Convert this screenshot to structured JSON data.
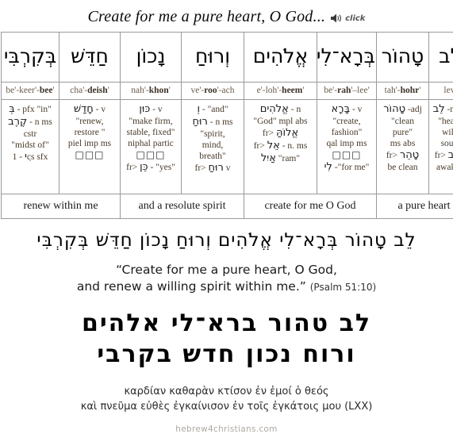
{
  "header": {
    "title": "Create for me a pure heart, O God...",
    "audio_icon": "speaker-icon",
    "click_label": "click"
  },
  "table": {
    "columns": [
      {
        "hebrew": "לֵב",
        "translit_pre": "lev",
        "translit_stress": "",
        "translit_post": "'",
        "parse_lines": [
          {
            "type": "mixed",
            "heb": "לֵב",
            "text": "-n ms"
          },
          {
            "type": "text",
            "text": "\"heart,"
          },
          {
            "type": "text",
            "text": "will,"
          },
          {
            "type": "text",
            "text": "soul\""
          },
          {
            "type": "mixed",
            "pre": "fr>",
            "heb": "לָבַב"
          },
          {
            "type": "text",
            "text": "awaken"
          }
        ],
        "gloss": "a pure heart"
      },
      {
        "hebrew": "טָהוֹר",
        "translit_pre": "tah'-",
        "translit_stress": "hohr",
        "translit_post": "'",
        "parse_lines": [
          {
            "type": "mixed",
            "heb": "טָהוֹר",
            "text": "-adj"
          },
          {
            "type": "text",
            "text": "\"clean"
          },
          {
            "type": "text",
            "text": "pure\""
          },
          {
            "type": "text",
            "text": "ms abs"
          },
          {
            "type": "mixed",
            "pre": "fr>",
            "heb": "טָהֵר"
          },
          {
            "type": "text",
            "text": "be clean"
          }
        ],
        "gloss": ""
      },
      {
        "hebrew": "בְּרָא־לִי",
        "translit_pre": "be'-",
        "translit_stress": "rah",
        "translit_post": "'–lee'",
        "parse_lines": [
          {
            "type": "mixed",
            "heb": "בָּרָא",
            "text": "- v"
          },
          {
            "type": "text",
            "text": "\"create,"
          },
          {
            "type": "text",
            "text": "fashion\""
          },
          {
            "type": "text",
            "text": "qal imp ms"
          },
          {
            "type": "tofu",
            "count": 3
          },
          {
            "type": "mixed",
            "heb": "לִי",
            "text": "-\"for me\""
          }
        ],
        "gloss": "create for me O God"
      },
      {
        "hebrew": "אֱלֹהִים",
        "translit_pre": "e'-loh'-",
        "translit_stress": "heem",
        "translit_post": "'",
        "parse_lines": [
          {
            "type": "mixed",
            "heb": "אֱלֹהִים",
            "text": "- n"
          },
          {
            "type": "text",
            "text": "\"God\" mpl abs"
          },
          {
            "type": "mixed",
            "pre": "fr>",
            "heb": "אֱלוֹהַּ"
          },
          {
            "type": "mixed",
            "pre": "fr>",
            "heb": "אֵל",
            "text": "- n. ms"
          },
          {
            "type": "mixed",
            "heb": "אַיִל",
            "text": "\"ram\""
          }
        ],
        "gloss": ""
      },
      {
        "hebrew": "וְרוּחַ",
        "translit_pre": "ve'-",
        "translit_stress": "roo",
        "translit_post": "'-ach",
        "parse_lines": [
          {
            "type": "mixed",
            "heb": "וְ",
            "text": "- \"and\""
          },
          {
            "type": "mixed",
            "heb": "רוּחַ",
            "text": "- n ms"
          },
          {
            "type": "text",
            "text": "\"spirit,"
          },
          {
            "type": "text",
            "text": "mind,"
          },
          {
            "type": "text",
            "text": "breath\""
          },
          {
            "type": "mixed",
            "pre": "fr>",
            "heb": "רוּחַ",
            "text": "v"
          }
        ],
        "gloss": "and a resolute spirit"
      },
      {
        "hebrew": "נָכוֹן",
        "translit_pre": "nah'-",
        "translit_stress": "khon",
        "translit_post": "'",
        "parse_lines": [
          {
            "type": "mixed",
            "heb": "כּוּן",
            "text": "- v"
          },
          {
            "type": "text",
            "text": "\"make firm,"
          },
          {
            "type": "text",
            "text": "stable, fixed\""
          },
          {
            "type": "text",
            "text": "niphal partic"
          },
          {
            "type": "tofu",
            "count": 3
          },
          {
            "type": "mixed",
            "pre": "fr>",
            "heb": "כֵּן",
            "text": "- \"yes\""
          }
        ],
        "gloss": ""
      },
      {
        "hebrew": "חַדֵּשׁ",
        "translit_pre": "cha'-",
        "translit_stress": "deish",
        "translit_post": "'",
        "parse_lines": [
          {
            "type": "mixed",
            "heb": "חָדַשׁ",
            "text": "- v"
          },
          {
            "type": "text",
            "text": "\"renew,"
          },
          {
            "type": "text",
            "text": "restore \""
          },
          {
            "type": "text",
            "text": "piel imp ms"
          },
          {
            "type": "tofu",
            "count": 3
          }
        ],
        "gloss": "renew within me"
      },
      {
        "hebrew": "בְּקִרְבִּי",
        "translit_pre": "be'-keer'-",
        "translit_stress": "bee",
        "translit_post": "'",
        "parse_lines": [
          {
            "type": "mixed",
            "heb": "בְּ",
            "text": "- pfx \"in\""
          },
          {
            "type": "mixed",
            "heb": "קֶרֶב",
            "text": "- n ms"
          },
          {
            "type": "text",
            "text": "cstr"
          },
          {
            "type": "text",
            "text": "\"midst of\""
          },
          {
            "type": "mixed",
            "heb": "ִי",
            "text": "- 1cs sfx"
          }
        ],
        "gloss": ""
      }
    ]
  },
  "verse": {
    "hebrew_pointed": "לֵב טָהוֹר בְּרָא־לִי אֱלֹהִים וְרוּחַ נָכוֹן חַדֵּשׁ בְּקִרְבִּי",
    "english_line1": "“Create for me a pure heart, O God,",
    "english_line2": "and renew a willing spirit within me.”",
    "reference": "(Psalm 51:10)",
    "hebrew_big_line1": "לב טהור ברא־לי אלהים",
    "hebrew_big_line2": "ורוח נכון חדש בקרבי",
    "greek_line1": "καρδίαν καθαρὰν κτίσον ἐν ἐμοί ὁ θεός",
    "greek_line2": "καὶ πνεῦμα εὐθὲς ἐγκαίνισον ἐν τοῖς ἐγκάτοις μου (LXX)"
  },
  "footer": {
    "site": "hebrew4christians.com"
  }
}
